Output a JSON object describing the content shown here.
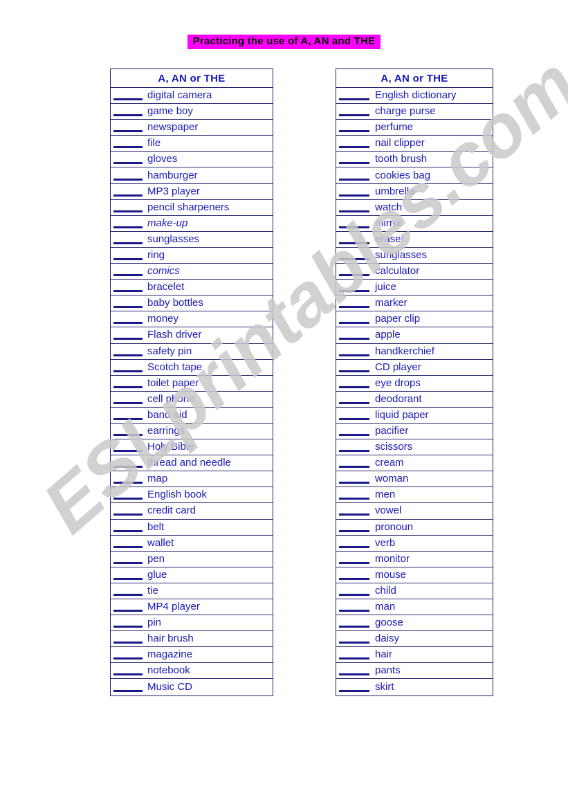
{
  "page": {
    "title": "Practicing the use of A, AN and THE",
    "title_bg_color": "#ff00ff",
    "title_text_color": "#000000",
    "accent_text_color": "#1a1ab4",
    "border_color": "#1a1a66"
  },
  "watermark": {
    "text": "ESLprintables.com",
    "color": "#c9c9c9"
  },
  "tables": {
    "left": {
      "header": "A, AN or THE",
      "rows": [
        {
          "blank": "",
          "word": "digital camera",
          "italic": false
        },
        {
          "blank": "",
          "word": "game boy",
          "italic": false
        },
        {
          "blank": "",
          "word": "newspaper",
          "italic": false
        },
        {
          "blank": "",
          "word": "file",
          "italic": false
        },
        {
          "blank": "",
          "word": "gloves",
          "italic": false
        },
        {
          "blank": "",
          "word": "hamburger",
          "italic": false
        },
        {
          "blank": "",
          "word": "MP3 player",
          "italic": false
        },
        {
          "blank": "",
          "word": "pencil sharpeners",
          "italic": false
        },
        {
          "blank": "",
          "word": "make-up",
          "italic": true
        },
        {
          "blank": "",
          "word": "sunglasses",
          "italic": false
        },
        {
          "blank": "",
          "word": "ring",
          "italic": false
        },
        {
          "blank": "",
          "word": "comics",
          "italic": true
        },
        {
          "blank": "",
          "word": "bracelet",
          "italic": false
        },
        {
          "blank": "",
          "word": "baby bottles",
          "italic": false
        },
        {
          "blank": "",
          "word": "money",
          "italic": false
        },
        {
          "blank": "",
          "word": "Flash driver",
          "italic": false
        },
        {
          "blank": "",
          "word": "safety pin",
          "italic": false
        },
        {
          "blank": "",
          "word": "Scotch tape",
          "italic": false
        },
        {
          "blank": "",
          "word": "toilet paper",
          "italic": false
        },
        {
          "blank": "",
          "word": "cell phone",
          "italic": false
        },
        {
          "blank": "",
          "word": "band aid",
          "italic": false
        },
        {
          "blank": "",
          "word": "earrings",
          "italic": false
        },
        {
          "blank": "",
          "word": "Holy Bible",
          "italic": false
        },
        {
          "blank": "",
          "word": "thread and needle",
          "italic": false
        },
        {
          "blank": "",
          "word": "map",
          "italic": false
        },
        {
          "blank": "",
          "word": "English book",
          "italic": false
        },
        {
          "blank": "",
          "word": "credit card",
          "italic": false
        },
        {
          "blank": "",
          "word": "belt",
          "italic": false
        },
        {
          "blank": "",
          "word": "wallet",
          "italic": false
        },
        {
          "blank": "",
          "word": "pen",
          "italic": false
        },
        {
          "blank": "",
          "word": "glue",
          "italic": false
        },
        {
          "blank": "",
          "word": "tie",
          "italic": false
        },
        {
          "blank": "",
          "word": "MP4 player",
          "italic": false
        },
        {
          "blank": "",
          "word": "pin",
          "italic": false
        },
        {
          "blank": "",
          "word": "hair brush",
          "italic": false
        },
        {
          "blank": "",
          "word": "magazine",
          "italic": false
        },
        {
          "blank": "",
          "word": "notebook",
          "italic": false
        },
        {
          "blank": "",
          "word": "Music CD",
          "italic": false
        }
      ]
    },
    "right": {
      "header": "A, AN or THE",
      "rows": [
        {
          "blank": "",
          "word": "English dictionary",
          "italic": false
        },
        {
          "blank": "",
          "word": "charge purse",
          "italic": false
        },
        {
          "blank": "",
          "word": "perfume",
          "italic": false
        },
        {
          "blank": "",
          "word": "nail clipper",
          "italic": false
        },
        {
          "blank": "",
          "word": "tooth brush",
          "italic": false
        },
        {
          "blank": "",
          "word": "cookies bag",
          "italic": false
        },
        {
          "blank": "",
          "word": "umbrella",
          "italic": false
        },
        {
          "blank": "",
          "word": "watch",
          "italic": false
        },
        {
          "blank": "",
          "word": "mirror",
          "italic": false
        },
        {
          "blank": "",
          "word": "eraser",
          "italic": false
        },
        {
          "blank": "",
          "word": "sunglasses",
          "italic": false
        },
        {
          "blank": "",
          "word": "calculator",
          "italic": false
        },
        {
          "blank": "",
          "word": "juice",
          "italic": false
        },
        {
          "blank": "",
          "word": "marker",
          "italic": false
        },
        {
          "blank": "",
          "word": "paper clip",
          "italic": false
        },
        {
          "blank": "",
          "word": "apple",
          "italic": false
        },
        {
          "blank": "",
          "word": "handkerchief",
          "italic": false
        },
        {
          "blank": "",
          "word": "CD player",
          "italic": false
        },
        {
          "blank": "",
          "word": "eye drops",
          "italic": false
        },
        {
          "blank": "",
          "word": "deodorant",
          "italic": false
        },
        {
          "blank": "",
          "word": "liquid paper",
          "italic": false
        },
        {
          "blank": "",
          "word": "pacifier",
          "italic": false
        },
        {
          "blank": "",
          "word": "scissors",
          "italic": false
        },
        {
          "blank": "",
          "word": "cream",
          "italic": false
        },
        {
          "blank": "",
          "word": "woman",
          "italic": false
        },
        {
          "blank": "",
          "word": "men",
          "italic": false
        },
        {
          "blank": "",
          "word": "vowel",
          "italic": false
        },
        {
          "blank": "",
          "word": "pronoun",
          "italic": false
        },
        {
          "blank": "",
          "word": "verb",
          "italic": false
        },
        {
          "blank": "",
          "word": "monitor",
          "italic": false
        },
        {
          "blank": "",
          "word": "mouse",
          "italic": false
        },
        {
          "blank": "",
          "word": "child",
          "italic": false
        },
        {
          "blank": "",
          "word": "man",
          "italic": false
        },
        {
          "blank": "",
          "word": "goose",
          "italic": false
        },
        {
          "blank": "",
          "word": "daisy",
          "italic": false
        },
        {
          "blank": "",
          "word": "hair",
          "italic": false
        },
        {
          "blank": "",
          "word": "pants",
          "italic": false
        },
        {
          "blank": "",
          "word": "skirt",
          "italic": false
        }
      ]
    }
  }
}
